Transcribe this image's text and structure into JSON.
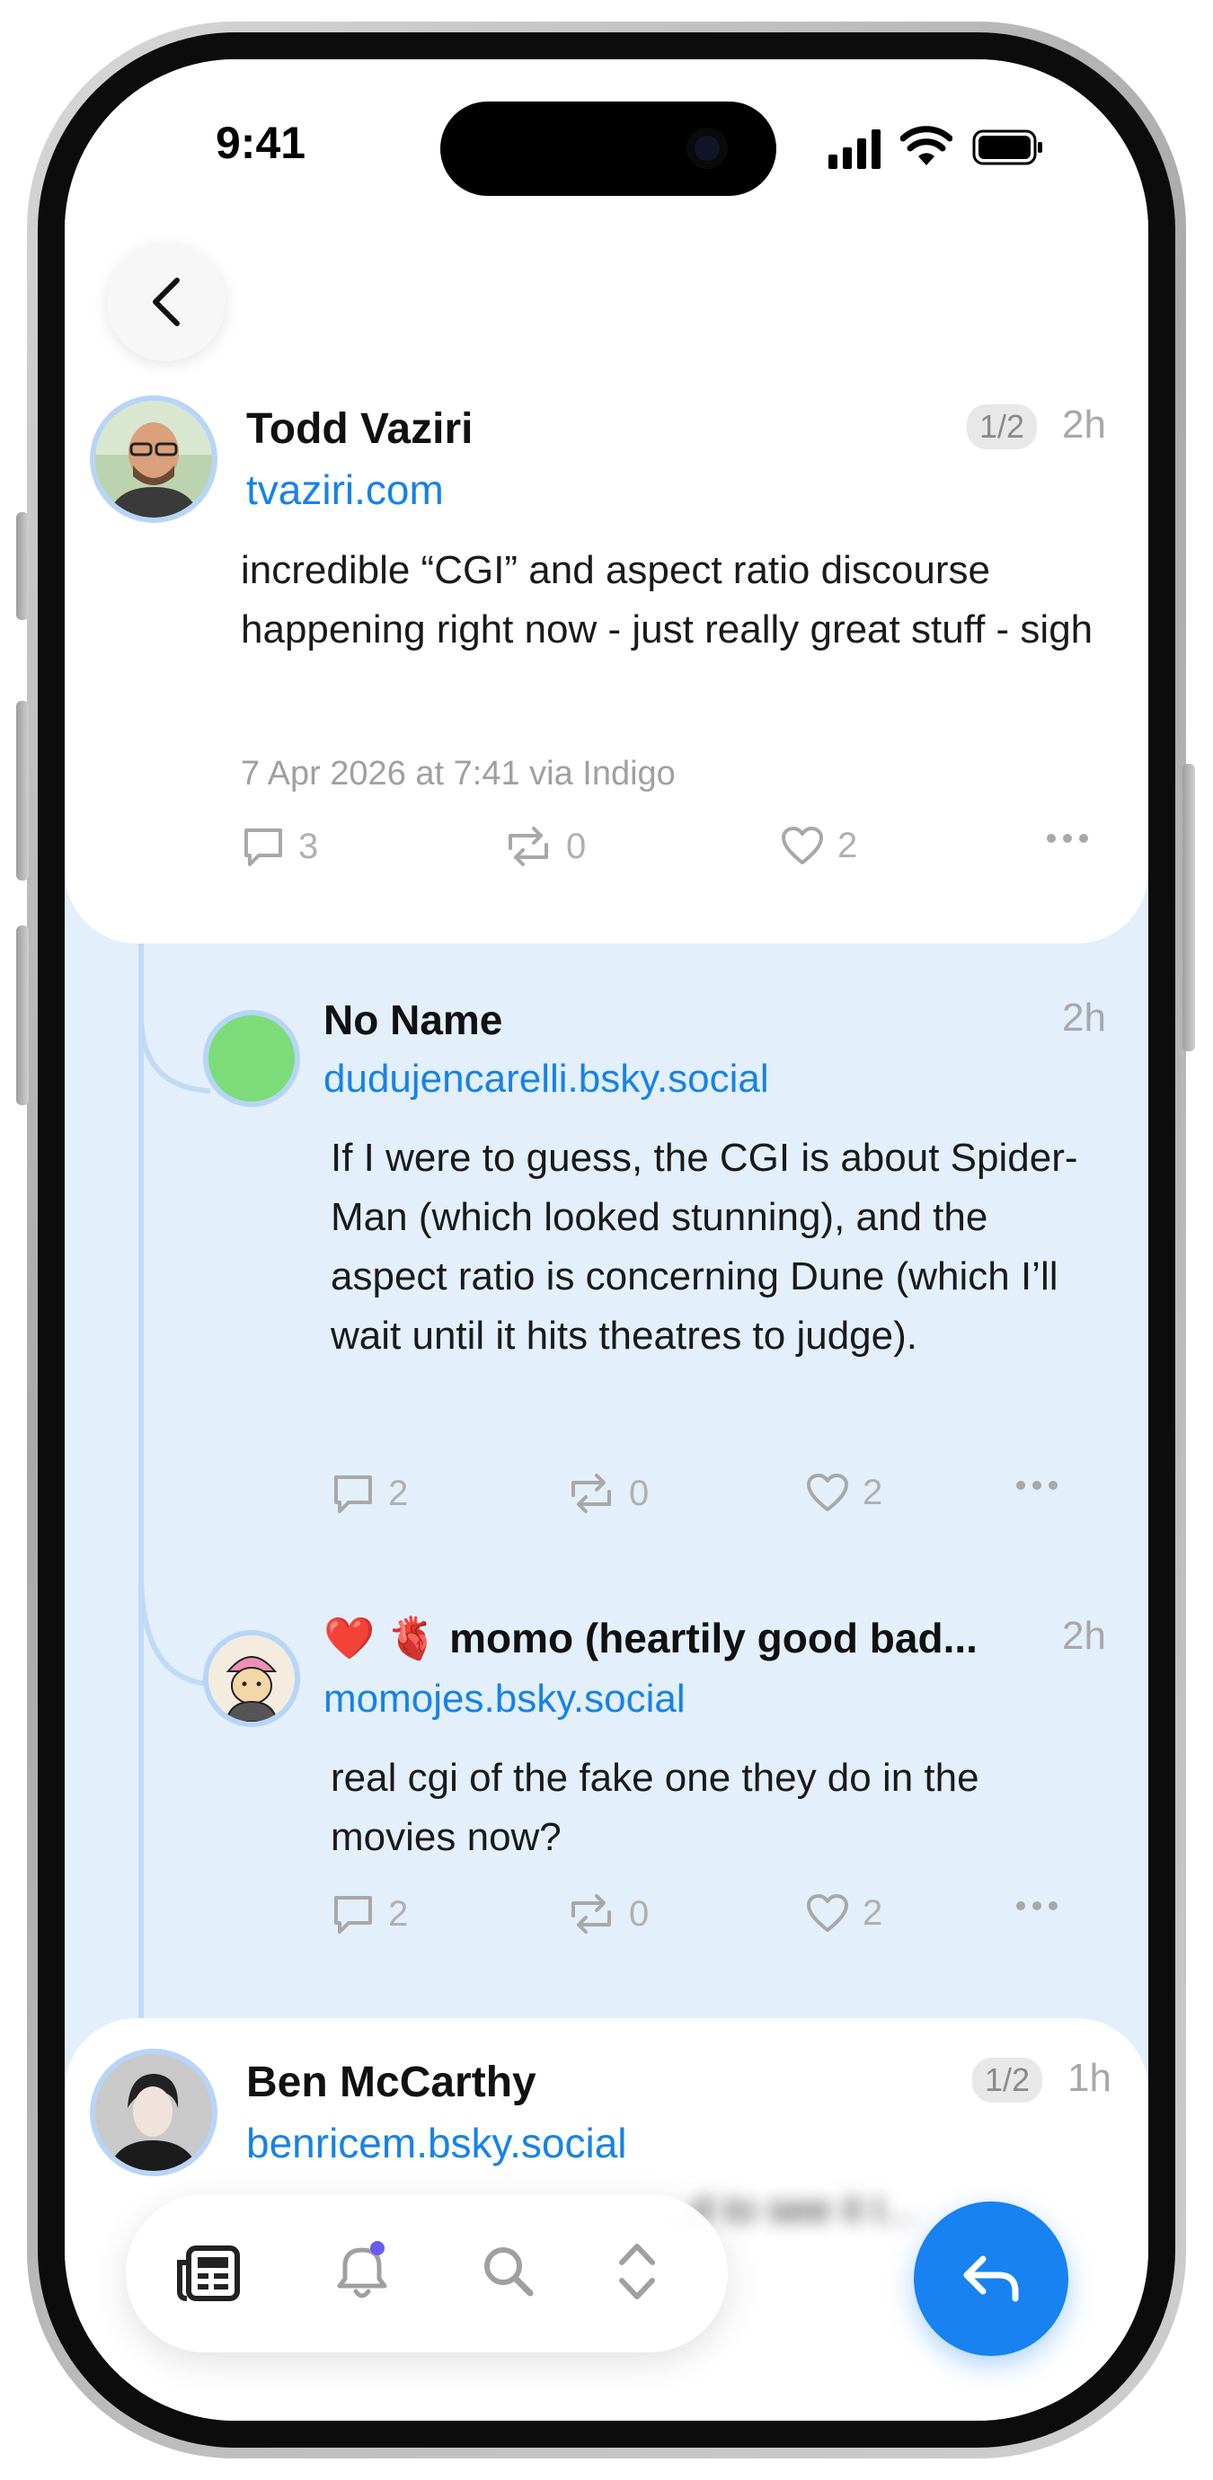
{
  "status_bar": {
    "time": "9:41"
  },
  "main_post": {
    "author": "Todd Vaziri",
    "handle": "tvaziri.com",
    "thread_index": "1/2",
    "age": "2h",
    "text": "incredible “CGI” and aspect ratio discourse happening right now - just really great stuff - sigh",
    "timestamp": "7 Apr 2026 at 7:41 via Indigo",
    "replies": "3",
    "reposts": "0",
    "likes": "2"
  },
  "replies": [
    {
      "author": "No Name",
      "handle": "dudujencarelli.bsky.social",
      "age": "2h",
      "text": "If I were to guess, the CGI is about Spider-Man (which looked stunning), and the aspect ratio is concerning Dune (which I’ll wait until it hits theatres to judge).",
      "replies": "2",
      "reposts": "0",
      "likes": "2",
      "avatar_color": "#7ddc7a"
    },
    {
      "author": "❤️ 🫀 momo (heartily good bad...",
      "handle": "momojes.bsky.social",
      "age": "2h",
      "text": "real cgi of the fake one they do in the movies now?",
      "replies": "2",
      "reposts": "0",
      "likes": "2"
    }
  ],
  "next_post": {
    "author": "Ben McCarthy",
    "handle": "benricem.bsky.social",
    "thread_index": "1/2",
    "age": "1h",
    "text_blurred": "...d to see it t..."
  },
  "tab_bar": {
    "items": [
      "feed-icon",
      "notifications-bell-icon",
      "search-icon",
      "thread-navigate-icon"
    ],
    "notification_dot_color": "#6a5cf0"
  },
  "colors": {
    "accent": "#1782f0",
    "thread_bg": "#e3effb",
    "handle": "#1782e8"
  }
}
